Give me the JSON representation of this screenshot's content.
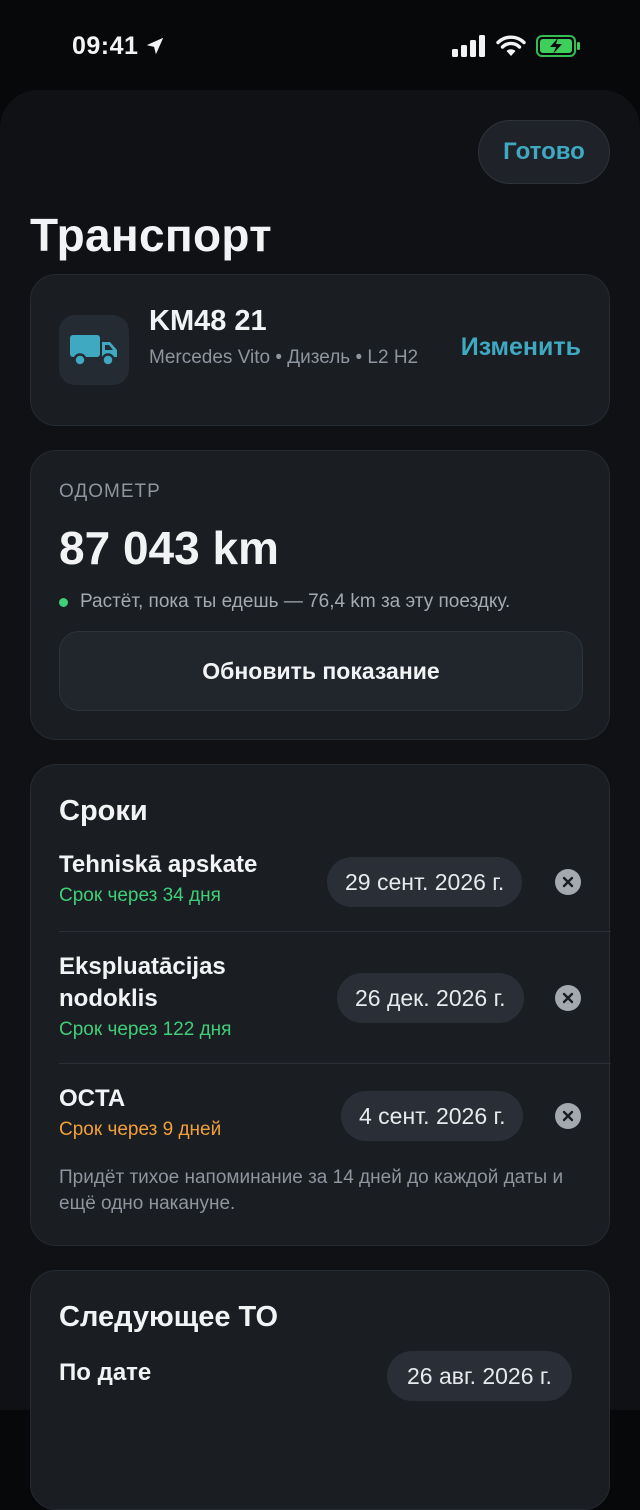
{
  "status_bar": {
    "time": "09:41"
  },
  "header": {
    "done_label": "Готово",
    "title": "Транспорт"
  },
  "vehicle": {
    "plate": "KM48 21",
    "description": "Mercedes Vito • Дизель • L2 H2",
    "edit_label": "Изменить"
  },
  "odometer": {
    "kicker": "ОДОМЕТР",
    "value": "87 043 km",
    "note": "Растёт, пока ты едешь — 76,4 km за эту поездку.",
    "update_label": "Обновить показание"
  },
  "deadlines": {
    "title": "Сроки",
    "items": [
      {
        "name": "Tehniskā apskate",
        "due": "Срок через 34 дня",
        "date": "29 сент. 2026 г.",
        "status": "ok"
      },
      {
        "name": "Ekspluatācijas nodoklis",
        "due": "Срок через 122 дня",
        "date": "26 дек. 2026 г.",
        "status": "ok"
      },
      {
        "name": "OCTA",
        "due": "Срок через 9 дней",
        "date": "4 сент. 2026 г.",
        "status": "soon"
      }
    ],
    "reminder_note": "Придёт тихое напоминание за 14 дней до каждой даты и ещё одно накануне."
  },
  "service": {
    "title": "Следующее ТО",
    "row_label": "По дате",
    "date": "26 авг. 2026 г."
  },
  "colors": {
    "accent": "#3fa9c2",
    "ok": "#3ecf78",
    "soon": "#f0a039",
    "background": "#0f1114",
    "card": "#1a1d22"
  }
}
